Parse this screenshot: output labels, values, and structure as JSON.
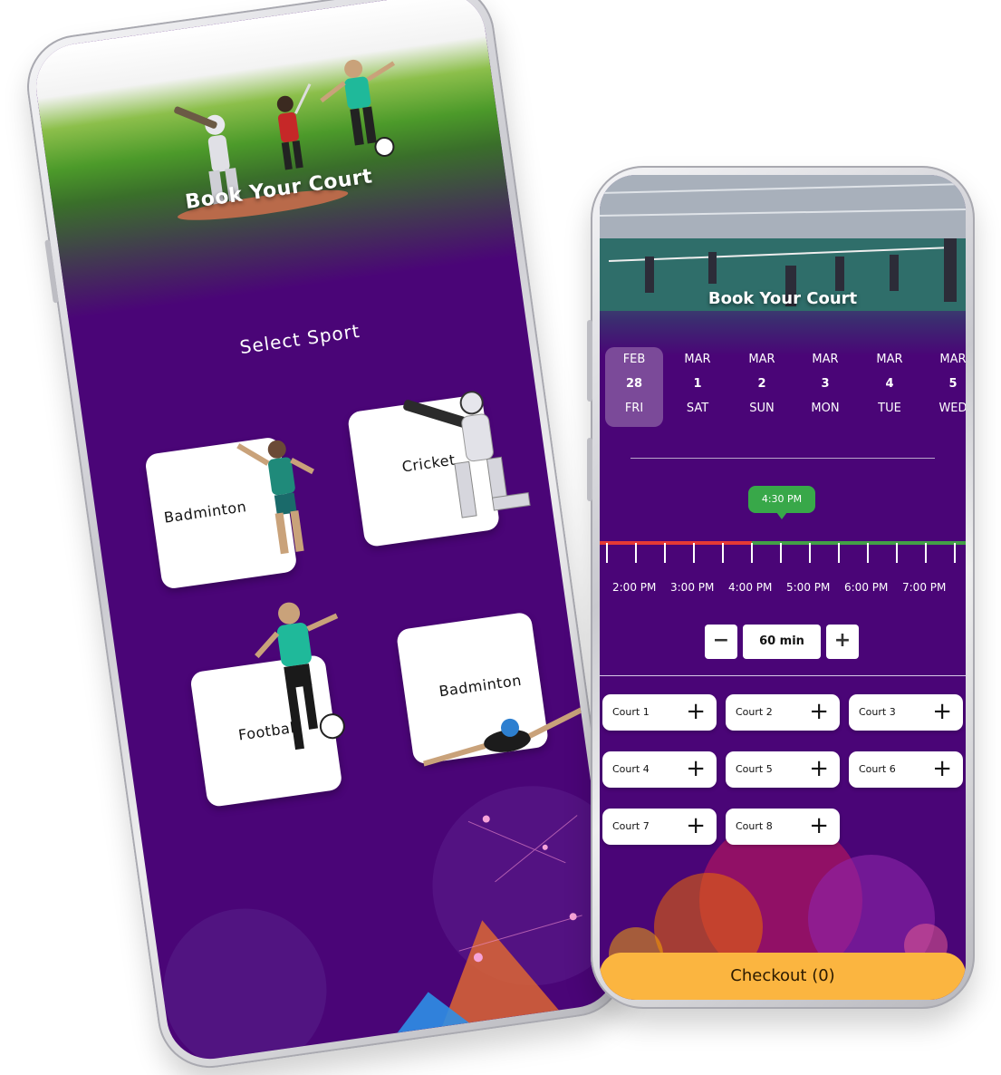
{
  "left_screen": {
    "hero_title": "Book Your Court",
    "select_title": "Select Sport",
    "sports": [
      {
        "label": "Badminton"
      },
      {
        "label": "Cricket"
      },
      {
        "label": "Football"
      },
      {
        "label": "Badminton"
      }
    ]
  },
  "right_screen": {
    "hero_title": "Book Your Court",
    "dates": [
      {
        "month": "FEB",
        "day": "28",
        "weekday": "FRI",
        "selected": true
      },
      {
        "month": "MAR",
        "day": "1",
        "weekday": "SAT"
      },
      {
        "month": "MAR",
        "day": "2",
        "weekday": "SUN"
      },
      {
        "month": "MAR",
        "day": "3",
        "weekday": "MON"
      },
      {
        "month": "MAR",
        "day": "4",
        "weekday": "TUE"
      },
      {
        "month": "MAR",
        "day": "5",
        "weekday": "WED"
      }
    ],
    "selected_time": "4:30 PM",
    "time_labels": [
      "2:00 PM",
      "3:00 PM",
      "4:00 PM",
      "5:00 PM",
      "6:00 PM",
      "7:00 PM"
    ],
    "duration": {
      "minus": "−",
      "value": "60 min",
      "plus": "+"
    },
    "courts": [
      {
        "name": "Court 1"
      },
      {
        "name": "Court 2"
      },
      {
        "name": "Court 3"
      },
      {
        "name": "Court 4"
      },
      {
        "name": "Court 5"
      },
      {
        "name": "Court 6"
      },
      {
        "name": "Court 7"
      },
      {
        "name": "Court 8"
      }
    ],
    "court_add_symbol": "+",
    "checkout_label": "Checkout (0)"
  },
  "colors": {
    "brand_purple": "#4a0577",
    "selected_date": "#7b4a99",
    "time_bubble": "#38a849",
    "timeline_past": "#e53935",
    "timeline_future": "#43a047",
    "checkout": "#fbb540"
  }
}
